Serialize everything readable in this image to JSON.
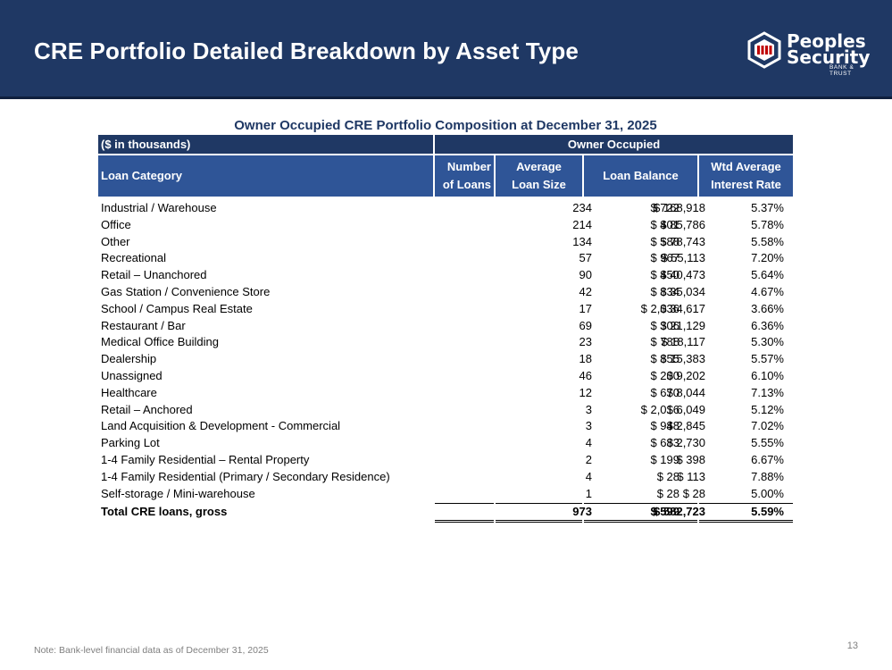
{
  "header": {
    "title": "CRE Portfolio Detailed Breakdown by Asset Type",
    "logo": {
      "line1": "Peoples",
      "line2": "Security",
      "sub": "BANK & TRUST",
      "icon": "bank-logo-icon"
    }
  },
  "table": {
    "title": "Owner Occupied CRE Portfolio Composition at December 31, 2025",
    "units_label": "($ in thousands)",
    "group_label": "Owner Occupied",
    "columns": {
      "category": "Loan Category",
      "num_line1": "Number",
      "num_line2": "of Loans",
      "avg_line1": "Average",
      "avg_line2": "Loan Size",
      "balance": "Loan Balance",
      "rate_line1": "Wtd Average",
      "rate_line2": "Interest Rate"
    },
    "rows": [
      {
        "category": "Industrial / Warehouse",
        "num": "234",
        "avg": "$ 722",
        "balance": "$ 168,918",
        "rate": "5.37%"
      },
      {
        "category": "Office",
        "num": "214",
        "avg": "$ 401",
        "balance": "$ 85,786",
        "rate": "5.78%"
      },
      {
        "category": "Other",
        "num": "134",
        "avg": "$ 588",
        "balance": "$ 78,743",
        "rate": "5.58%"
      },
      {
        "category": "Recreational",
        "num": "57",
        "avg": "$ 967",
        "balance": "$ 55,113",
        "rate": "7.20%"
      },
      {
        "category": "Retail – Unanchored",
        "num": "90",
        "avg": "$ 450",
        "balance": "$ 40,473",
        "rate": "5.64%"
      },
      {
        "category": "Gas Station / Convenience Store",
        "num": "42",
        "avg": "$ 834",
        "balance": "$ 35,034",
        "rate": "4.67%"
      },
      {
        "category": "School / Campus Real Estate",
        "num": "17",
        "avg": "$ 2,036",
        "balance": "$ 34,617",
        "rate": "3.66%"
      },
      {
        "category": "Restaurant / Bar",
        "num": "69",
        "avg": "$ 306",
        "balance": "$ 21,129",
        "rate": "6.36%"
      },
      {
        "category": "Medical Office Building",
        "num": "23",
        "avg": "$ 788",
        "balance": "$ 18,117",
        "rate": "5.30%"
      },
      {
        "category": "Dealership",
        "num": "18",
        "avg": "$ 855",
        "balance": "$ 15,383",
        "rate": "5.57%"
      },
      {
        "category": "Unassigned",
        "num": "46",
        "avg": "$ 200",
        "balance": "$ 9,202",
        "rate": "6.10%"
      },
      {
        "category": "Healthcare",
        "num": "12",
        "avg": "$ 670",
        "balance": "$ 8,044",
        "rate": "7.13%"
      },
      {
        "category": "Retail – Anchored",
        "num": "3",
        "avg": "$ 2,016",
        "balance": "$ 6,049",
        "rate": "5.12%"
      },
      {
        "category": "Land Acquisition & Development - Commercial",
        "num": "3",
        "avg": "$ 948",
        "balance": "$ 2,845",
        "rate": "7.02%"
      },
      {
        "category": "Parking Lot",
        "num": "4",
        "avg": "$ 683",
        "balance": "$ 2,730",
        "rate": "5.55%"
      },
      {
        "category": "1-4 Family Residential – Rental Property",
        "num": "2",
        "avg": "$ 199",
        "balance": "$ 398",
        "rate": "6.67%"
      },
      {
        "category": "1-4 Family Residential (Primary / Secondary Residence)",
        "num": "4",
        "avg": "$ 28",
        "balance": "$ 113",
        "rate": "7.88%"
      },
      {
        "category": "Self-storage / Mini-warehouse",
        "num": "1",
        "avg": "$ 28",
        "balance": "$ 28",
        "rate": "5.00%"
      }
    ],
    "total": {
      "category": "Total CRE loans, gross",
      "num": "973",
      "avg": "$ 599",
      "balance": "$ 582,723",
      "rate": "5.59%"
    }
  },
  "footer": {
    "note": "Note: Bank-level financial data as of December 31, 2025",
    "page_number": "13"
  },
  "colors": {
    "navy": "#1f3864",
    "header_blue": "#2f5597",
    "footnote_gray": "#7f7f7f"
  }
}
